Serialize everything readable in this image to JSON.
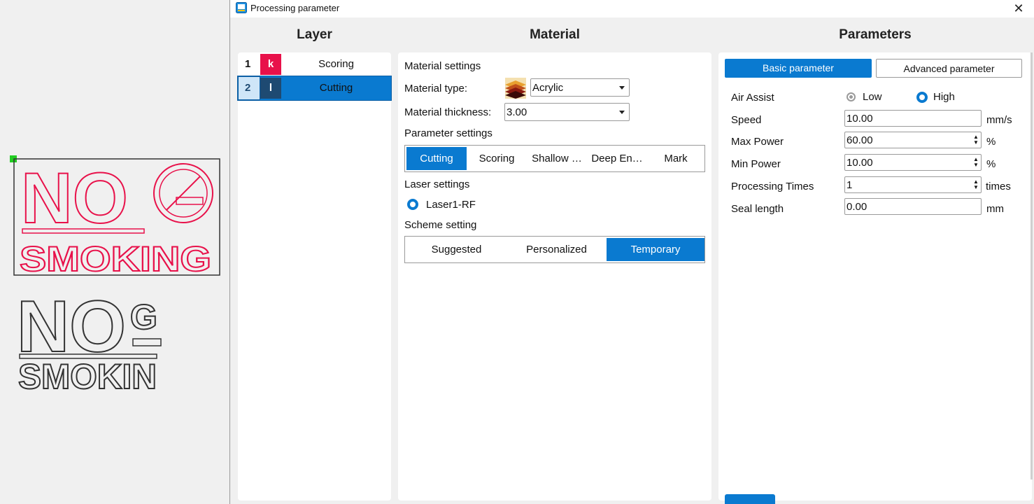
{
  "window": {
    "title": "Processing parameter",
    "close_glyph": "✕"
  },
  "columns": {
    "layer": "Layer",
    "material": "Material",
    "parameters": "Parameters"
  },
  "layers": [
    {
      "num": "1",
      "code": "k",
      "name": "Scoring",
      "color": "#e8114a"
    },
    {
      "num": "2",
      "code": "l",
      "name": "Cutting",
      "color": "#1e4a72"
    }
  ],
  "material": {
    "settings_heading": "Material settings",
    "type_label": "Material type:",
    "type_value": "Acrylic",
    "thickness_label": "Material thickness:",
    "thickness_value": "3.00",
    "param_heading": "Parameter settings",
    "param_tabs": [
      "Cutting",
      "Scoring",
      "Shallow …",
      "Deep En…",
      "Mark"
    ],
    "laser_heading": "Laser settings",
    "laser_option": "Laser1-RF",
    "scheme_heading": "Scheme setting",
    "scheme_tabs": [
      "Suggested",
      "Personalized",
      "Temporary"
    ]
  },
  "parameters": {
    "tabs": [
      "Basic parameter",
      "Advanced parameter"
    ],
    "air_assist_label": "Air Assist",
    "air_low": "Low",
    "air_high": "High",
    "speed_label": "Speed",
    "speed_value": "10.00",
    "speed_unit": "mm/s",
    "max_power_label": "Max Power",
    "max_power_value": "60.00",
    "max_power_unit": "%",
    "min_power_label": "Min Power",
    "min_power_value": "10.00",
    "min_power_unit": "%",
    "times_label": "Processing Times",
    "times_value": "1",
    "times_unit": "times",
    "seal_label": "Seal length",
    "seal_value": "0.00",
    "seal_unit": "mm"
  },
  "canvas": {
    "sign1_line1": "NO",
    "sign1_line2": "SMOKING",
    "sign2_line1": "NO",
    "sign2_g": "G",
    "sign2_line2": "SMOKIN"
  },
  "colors": {
    "accent": "#0a7ad0",
    "scoring": "#e8114a",
    "cutting": "#1e4a72"
  }
}
